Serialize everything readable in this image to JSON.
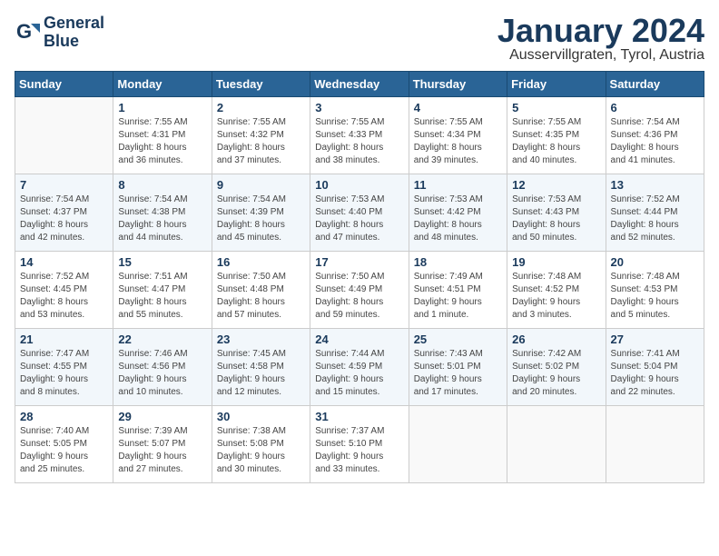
{
  "header": {
    "logo_line1": "General",
    "logo_line2": "Blue",
    "month": "January 2024",
    "location": "Ausservillgraten, Tyrol, Austria"
  },
  "weekdays": [
    "Sunday",
    "Monday",
    "Tuesday",
    "Wednesday",
    "Thursday",
    "Friday",
    "Saturday"
  ],
  "weeks": [
    [
      {
        "day": "",
        "info": ""
      },
      {
        "day": "1",
        "info": "Sunrise: 7:55 AM\nSunset: 4:31 PM\nDaylight: 8 hours\nand 36 minutes."
      },
      {
        "day": "2",
        "info": "Sunrise: 7:55 AM\nSunset: 4:32 PM\nDaylight: 8 hours\nand 37 minutes."
      },
      {
        "day": "3",
        "info": "Sunrise: 7:55 AM\nSunset: 4:33 PM\nDaylight: 8 hours\nand 38 minutes."
      },
      {
        "day": "4",
        "info": "Sunrise: 7:55 AM\nSunset: 4:34 PM\nDaylight: 8 hours\nand 39 minutes."
      },
      {
        "day": "5",
        "info": "Sunrise: 7:55 AM\nSunset: 4:35 PM\nDaylight: 8 hours\nand 40 minutes."
      },
      {
        "day": "6",
        "info": "Sunrise: 7:54 AM\nSunset: 4:36 PM\nDaylight: 8 hours\nand 41 minutes."
      }
    ],
    [
      {
        "day": "7",
        "info": "Sunrise: 7:54 AM\nSunset: 4:37 PM\nDaylight: 8 hours\nand 42 minutes."
      },
      {
        "day": "8",
        "info": "Sunrise: 7:54 AM\nSunset: 4:38 PM\nDaylight: 8 hours\nand 44 minutes."
      },
      {
        "day": "9",
        "info": "Sunrise: 7:54 AM\nSunset: 4:39 PM\nDaylight: 8 hours\nand 45 minutes."
      },
      {
        "day": "10",
        "info": "Sunrise: 7:53 AM\nSunset: 4:40 PM\nDaylight: 8 hours\nand 47 minutes."
      },
      {
        "day": "11",
        "info": "Sunrise: 7:53 AM\nSunset: 4:42 PM\nDaylight: 8 hours\nand 48 minutes."
      },
      {
        "day": "12",
        "info": "Sunrise: 7:53 AM\nSunset: 4:43 PM\nDaylight: 8 hours\nand 50 minutes."
      },
      {
        "day": "13",
        "info": "Sunrise: 7:52 AM\nSunset: 4:44 PM\nDaylight: 8 hours\nand 52 minutes."
      }
    ],
    [
      {
        "day": "14",
        "info": "Sunrise: 7:52 AM\nSunset: 4:45 PM\nDaylight: 8 hours\nand 53 minutes."
      },
      {
        "day": "15",
        "info": "Sunrise: 7:51 AM\nSunset: 4:47 PM\nDaylight: 8 hours\nand 55 minutes."
      },
      {
        "day": "16",
        "info": "Sunrise: 7:50 AM\nSunset: 4:48 PM\nDaylight: 8 hours\nand 57 minutes."
      },
      {
        "day": "17",
        "info": "Sunrise: 7:50 AM\nSunset: 4:49 PM\nDaylight: 8 hours\nand 59 minutes."
      },
      {
        "day": "18",
        "info": "Sunrise: 7:49 AM\nSunset: 4:51 PM\nDaylight: 9 hours\nand 1 minute."
      },
      {
        "day": "19",
        "info": "Sunrise: 7:48 AM\nSunset: 4:52 PM\nDaylight: 9 hours\nand 3 minutes."
      },
      {
        "day": "20",
        "info": "Sunrise: 7:48 AM\nSunset: 4:53 PM\nDaylight: 9 hours\nand 5 minutes."
      }
    ],
    [
      {
        "day": "21",
        "info": "Sunrise: 7:47 AM\nSunset: 4:55 PM\nDaylight: 9 hours\nand 8 minutes."
      },
      {
        "day": "22",
        "info": "Sunrise: 7:46 AM\nSunset: 4:56 PM\nDaylight: 9 hours\nand 10 minutes."
      },
      {
        "day": "23",
        "info": "Sunrise: 7:45 AM\nSunset: 4:58 PM\nDaylight: 9 hours\nand 12 minutes."
      },
      {
        "day": "24",
        "info": "Sunrise: 7:44 AM\nSunset: 4:59 PM\nDaylight: 9 hours\nand 15 minutes."
      },
      {
        "day": "25",
        "info": "Sunrise: 7:43 AM\nSunset: 5:01 PM\nDaylight: 9 hours\nand 17 minutes."
      },
      {
        "day": "26",
        "info": "Sunrise: 7:42 AM\nSunset: 5:02 PM\nDaylight: 9 hours\nand 20 minutes."
      },
      {
        "day": "27",
        "info": "Sunrise: 7:41 AM\nSunset: 5:04 PM\nDaylight: 9 hours\nand 22 minutes."
      }
    ],
    [
      {
        "day": "28",
        "info": "Sunrise: 7:40 AM\nSunset: 5:05 PM\nDaylight: 9 hours\nand 25 minutes."
      },
      {
        "day": "29",
        "info": "Sunrise: 7:39 AM\nSunset: 5:07 PM\nDaylight: 9 hours\nand 27 minutes."
      },
      {
        "day": "30",
        "info": "Sunrise: 7:38 AM\nSunset: 5:08 PM\nDaylight: 9 hours\nand 30 minutes."
      },
      {
        "day": "31",
        "info": "Sunrise: 7:37 AM\nSunset: 5:10 PM\nDaylight: 9 hours\nand 33 minutes."
      },
      {
        "day": "",
        "info": ""
      },
      {
        "day": "",
        "info": ""
      },
      {
        "day": "",
        "info": ""
      }
    ]
  ]
}
